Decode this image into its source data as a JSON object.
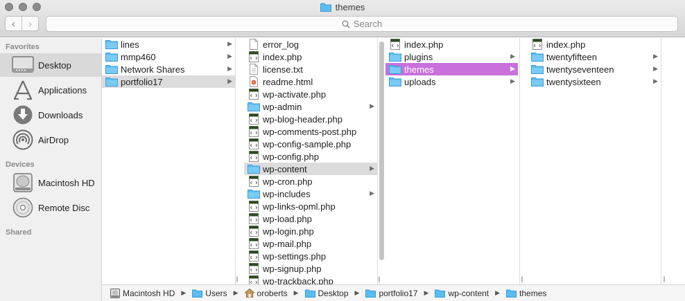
{
  "window": {
    "title": "themes"
  },
  "toolbar": {
    "back_glyph": "‹",
    "forward_glyph": "›",
    "search_placeholder": "Search"
  },
  "sidebar": {
    "sections": [
      {
        "title": "Favorites",
        "items": [
          {
            "label": "Desktop",
            "icon": "desktop-icon",
            "selected": true
          },
          {
            "label": "Applications",
            "icon": "applications-icon"
          },
          {
            "label": "Downloads",
            "icon": "downloads-icon"
          },
          {
            "label": "AirDrop",
            "icon": "airdrop-icon"
          }
        ]
      },
      {
        "title": "Devices",
        "items": [
          {
            "label": "Macintosh HD",
            "icon": "hard-drive-icon"
          },
          {
            "label": "Remote Disc",
            "icon": "disc-icon"
          }
        ]
      },
      {
        "title": "Shared",
        "items": []
      }
    ]
  },
  "columns": [
    {
      "items": [
        {
          "label": "lines",
          "type": "folder"
        },
        {
          "label": "mmp460",
          "type": "folder"
        },
        {
          "label": "Network Shares",
          "type": "folder"
        },
        {
          "label": "portfolio17",
          "type": "folder",
          "selected": "grey"
        }
      ]
    },
    {
      "items": [
        {
          "label": "error_log",
          "type": "doc"
        },
        {
          "label": "index.php",
          "type": "php"
        },
        {
          "label": "license.txt",
          "type": "doc"
        },
        {
          "label": "readme.html",
          "type": "html"
        },
        {
          "label": "wp-activate.php",
          "type": "php"
        },
        {
          "label": "wp-admin",
          "type": "folder"
        },
        {
          "label": "wp-blog-header.php",
          "type": "php"
        },
        {
          "label": "wp-comments-post.php",
          "type": "php"
        },
        {
          "label": "wp-config-sample.php",
          "type": "php"
        },
        {
          "label": "wp-config.php",
          "type": "php"
        },
        {
          "label": "wp-content",
          "type": "folder",
          "selected": "grey"
        },
        {
          "label": "wp-cron.php",
          "type": "php"
        },
        {
          "label": "wp-includes",
          "type": "folder"
        },
        {
          "label": "wp-links-opml.php",
          "type": "php"
        },
        {
          "label": "wp-load.php",
          "type": "php"
        },
        {
          "label": "wp-login.php",
          "type": "php"
        },
        {
          "label": "wp-mail.php",
          "type": "php"
        },
        {
          "label": "wp-settings.php",
          "type": "php"
        },
        {
          "label": "wp-signup.php",
          "type": "php"
        },
        {
          "label": "wp-trackback.php",
          "type": "php"
        }
      ]
    },
    {
      "items": [
        {
          "label": "index.php",
          "type": "php"
        },
        {
          "label": "plugins",
          "type": "folder"
        },
        {
          "label": "themes",
          "type": "folder",
          "selected": "pink"
        },
        {
          "label": "uploads",
          "type": "folder"
        }
      ]
    },
    {
      "items": [
        {
          "label": "index.php",
          "type": "php"
        },
        {
          "label": "twentyfifteen",
          "type": "folder"
        },
        {
          "label": "twentyseventeen",
          "type": "folder"
        },
        {
          "label": "twentysixteen",
          "type": "folder"
        }
      ]
    }
  ],
  "pathbar": [
    {
      "label": "Macintosh HD",
      "icon": "hard-drive-icon"
    },
    {
      "label": "Users",
      "icon": "folder-icon"
    },
    {
      "label": "oroberts",
      "icon": "home-icon"
    },
    {
      "label": "Desktop",
      "icon": "folder-icon"
    },
    {
      "label": "portfolio17",
      "icon": "folder-icon"
    },
    {
      "label": "wp-content",
      "icon": "folder-icon"
    },
    {
      "label": "themes",
      "icon": "folder-icon"
    }
  ],
  "colors": {
    "folder": "#5bbcf0",
    "selection_active": "#c970dc",
    "selection_inactive": "#dcdcdc"
  }
}
